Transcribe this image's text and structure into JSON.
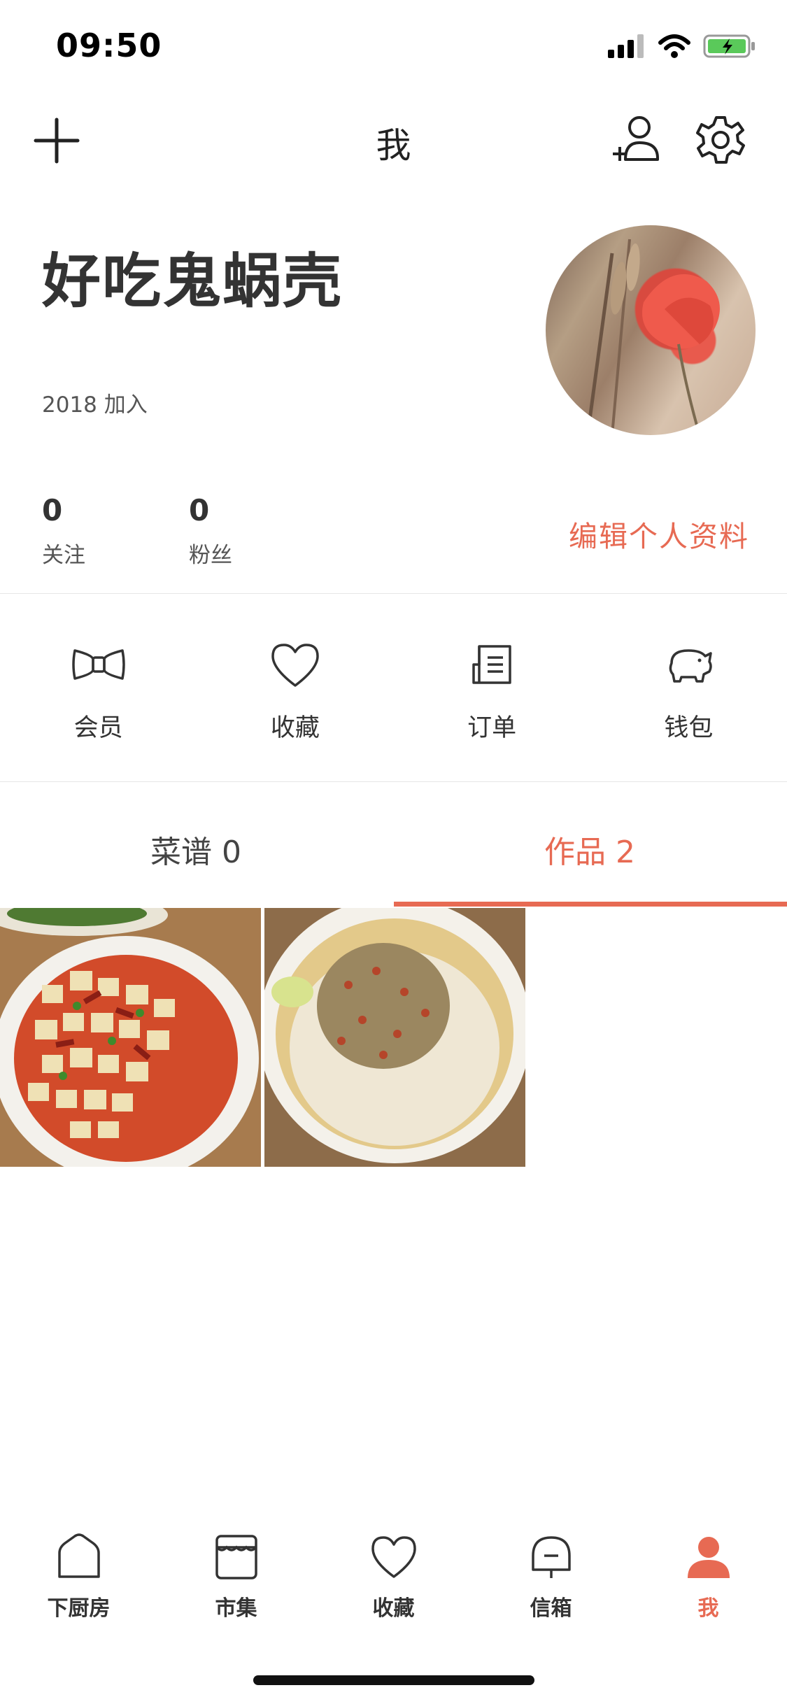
{
  "status_bar": {
    "time": "09:50"
  },
  "nav": {
    "title": "我"
  },
  "profile": {
    "username": "好吃鬼蜗壳",
    "joined": "2018 加入",
    "following_count": "0",
    "following_label": "关注",
    "followers_count": "0",
    "followers_label": "粉丝",
    "edit_label": "编辑个人资料"
  },
  "quick_actions": [
    {
      "label": "会员",
      "icon": "bowtie-icon"
    },
    {
      "label": "收藏",
      "icon": "heart-icon"
    },
    {
      "label": "订单",
      "icon": "receipt-icon"
    },
    {
      "label": "钱包",
      "icon": "piggy-bank-icon"
    }
  ],
  "tabs": {
    "recipes": "菜谱 0",
    "works": "作品 2",
    "active": "works"
  },
  "tabbar": [
    {
      "label": "下厨房",
      "icon": "home-icon"
    },
    {
      "label": "市集",
      "icon": "market-icon"
    },
    {
      "label": "收藏",
      "icon": "heart-icon"
    },
    {
      "label": "信箱",
      "icon": "mailbox-icon"
    },
    {
      "label": "我",
      "icon": "person-icon",
      "active": true
    }
  ],
  "colors": {
    "accent": "#e76a53",
    "text": "#333333",
    "divider": "#e6e6e6"
  }
}
